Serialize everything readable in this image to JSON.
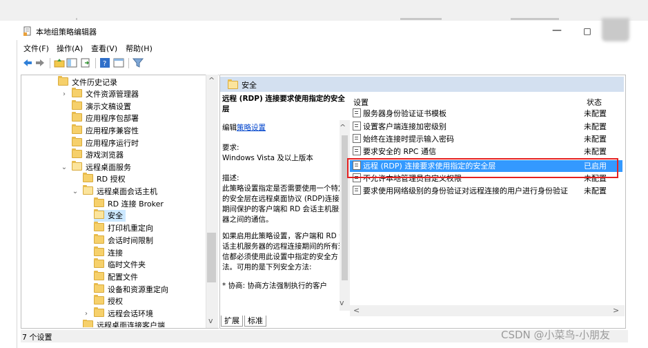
{
  "window": {
    "title": "本地组策略编辑器",
    "minimize_glyph": "—",
    "maximize_glyph": "□"
  },
  "menu": [
    "文件(F)",
    "操作(A)",
    "查看(V)",
    "帮助(H)"
  ],
  "toolbar_icons": [
    "back-arrow-icon",
    "forward-arrow-icon",
    "up-folder-icon",
    "show-hide-tree-icon",
    "export-list-icon",
    "help-icon",
    "properties-icon",
    "filter-icon"
  ],
  "tree": [
    {
      "label": "文件历史记录",
      "expander": ""
    },
    {
      "label": "文件资源管理器",
      "expander": "›"
    },
    {
      "label": "演示文稿设置",
      "expander": ""
    },
    {
      "label": "应用程序包部署",
      "expander": ""
    },
    {
      "label": "应用程序兼容性",
      "expander": ""
    },
    {
      "label": "应用程序运行时",
      "expander": ""
    },
    {
      "label": "游戏浏览器",
      "expander": ""
    },
    {
      "label": "远程桌面服务",
      "expander": "⌄"
    },
    {
      "label": "RD 授权",
      "expander": ""
    },
    {
      "label": "远程桌面会话主机",
      "expander": "⌄"
    },
    {
      "label": "RD 连接 Broker",
      "expander": ""
    },
    {
      "label": "安全",
      "expander": ""
    },
    {
      "label": "打印机重定向",
      "expander": ""
    },
    {
      "label": "会话时间限制",
      "expander": ""
    },
    {
      "label": "连接",
      "expander": ""
    },
    {
      "label": "临时文件夹",
      "expander": ""
    },
    {
      "label": "配置文件",
      "expander": ""
    },
    {
      "label": "设备和资源重定向",
      "expander": ""
    },
    {
      "label": "授权",
      "expander": ""
    },
    {
      "label": "远程会话环境",
      "expander": "›"
    },
    {
      "label": "远程桌面连接客户端",
      "expander": "›"
    }
  ],
  "tree_scroll": {
    "up": "^",
    "down": "v"
  },
  "right_pane": {
    "header": "安全",
    "desc_title": "远程 (RDP) 连接要求使用指定的安全层",
    "edit_prefix": "编辑",
    "edit_link": "策略设置",
    "requirements_label": "要求:",
    "requirements_value": "Windows Vista 及以上版本",
    "description_label": "描述:",
    "description_p1": "此策略设置指定是否需要使用一个特定的安全层在远程桌面协议 (RDP)连接期间保护的客户端和 RD 会话主机服务器之间的通信。",
    "description_p2": "如果启用此策略设置，客户端和 RD 会话主机服务器的远程连接期间的所有通信都必须使用此设置中指定的安全方法。可用的是下列安全方法:",
    "description_p3": "* 协商: 协商方法强制执行的客户",
    "col_setting": "设置",
    "col_state": "状态",
    "scroll": {
      "up": "^",
      "down": "v",
      "left": "<",
      "right": ">"
    }
  },
  "settings": [
    {
      "name": "服务器身份验证证书模板",
      "state": "未配置"
    },
    {
      "name": "设置客户端连接加密级别",
      "state": "未配置"
    },
    {
      "name": "始终在连接时提示输入密码",
      "state": "未配置"
    },
    {
      "name": "要求安全的 RPC 通信",
      "state": "未配置"
    },
    {
      "name": "远程 (RDP) 连接要求使用指定的安全层",
      "state": "已启用"
    },
    {
      "name": "不允许本地管理员自定义权限",
      "state": "未配置"
    },
    {
      "name": "要求使用网络级别的身份验证对远程连接的用户进行身份验证",
      "state": "未配置"
    }
  ],
  "tabs": [
    "扩展",
    "标准"
  ],
  "status": "7 个设置",
  "watermark": "CSDN @小菜鸟-小朋友",
  "colors": {
    "selection": "#3399ff",
    "highlight_box": "#e52020",
    "header_band": "#d3e0f0",
    "folder": "#f6d06b"
  }
}
